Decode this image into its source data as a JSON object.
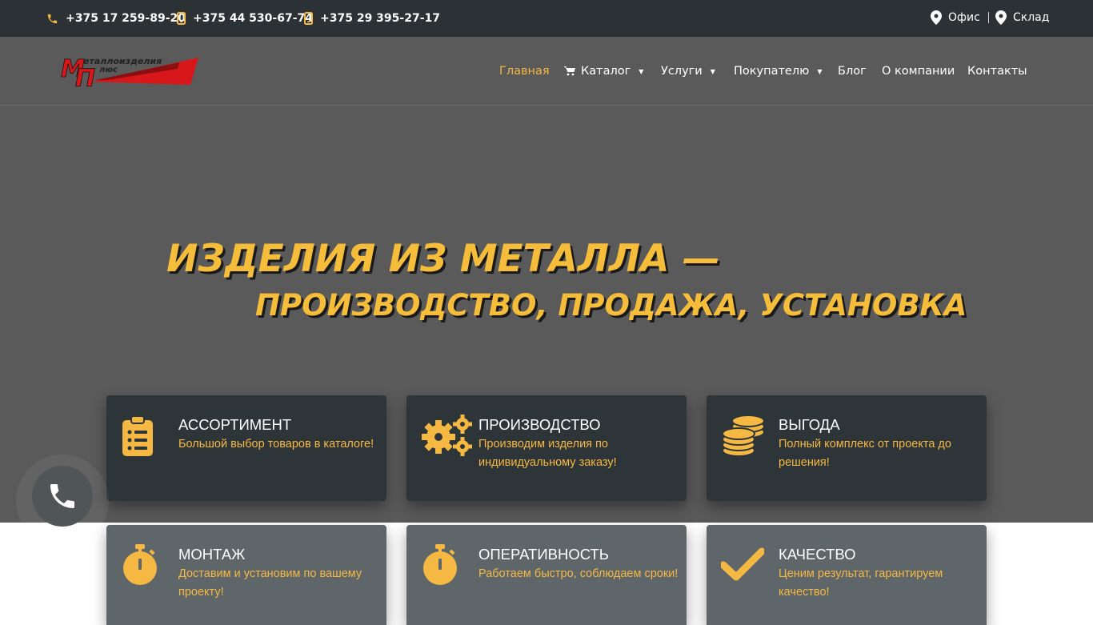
{
  "topbar": {
    "phones": [
      "+375 17 259-89-20",
      "+375 44 530-67-74",
      "+375 29 395-27-17"
    ],
    "locations": [
      "Офис",
      "Склад"
    ]
  },
  "logo": {
    "line1": "Металлоизделия",
    "line2": "плюс",
    "mark": "МП"
  },
  "nav": {
    "home": "Главная",
    "catalog": "Каталог",
    "services": "Услуги",
    "buyer": "Покупателю",
    "blog": "Блог",
    "about": "О компании",
    "contacts": "Контакты"
  },
  "hero": {
    "line1": "ИЗДЕЛИЯ ИЗ МЕТАЛЛА —",
    "line2": "ПРОИЗВОДСТВО, ПРОДАЖА, УСТАНОВКА"
  },
  "features": [
    {
      "title": "АССОРТИМЕНТ",
      "text": "Большой выбор товаров в каталоге!",
      "icon": "clipboard-list-icon"
    },
    {
      "title": "ПРОИЗВОДСТВО",
      "text": "Производим изделия по индивидуальному заказу!",
      "icon": "gears-icon"
    },
    {
      "title": "ВЫГОДА",
      "text": "Полный комплекс от проекта до решения!",
      "icon": "coins-icon"
    },
    {
      "title": "МОНТАЖ",
      "text": "Доставим и установим по вашему проекту!",
      "icon": "stopwatch-icon"
    },
    {
      "title": "ОПЕРАТИВНОСТЬ",
      "text": "Работаем быстро, соблюдаем сроки!",
      "icon": "stopwatch-icon"
    },
    {
      "title": "КАЧЕСТВО",
      "text": "Ценим результат, гарантируем качество!",
      "icon": "checkmark-icon"
    }
  ],
  "colors": {
    "accent": "#f5b843",
    "topbar": "#2c3135",
    "hero": "#5a5a5a",
    "card_dark": "#2e3539",
    "card_gray": "#5f666a",
    "logo_red": "#d8171b"
  }
}
